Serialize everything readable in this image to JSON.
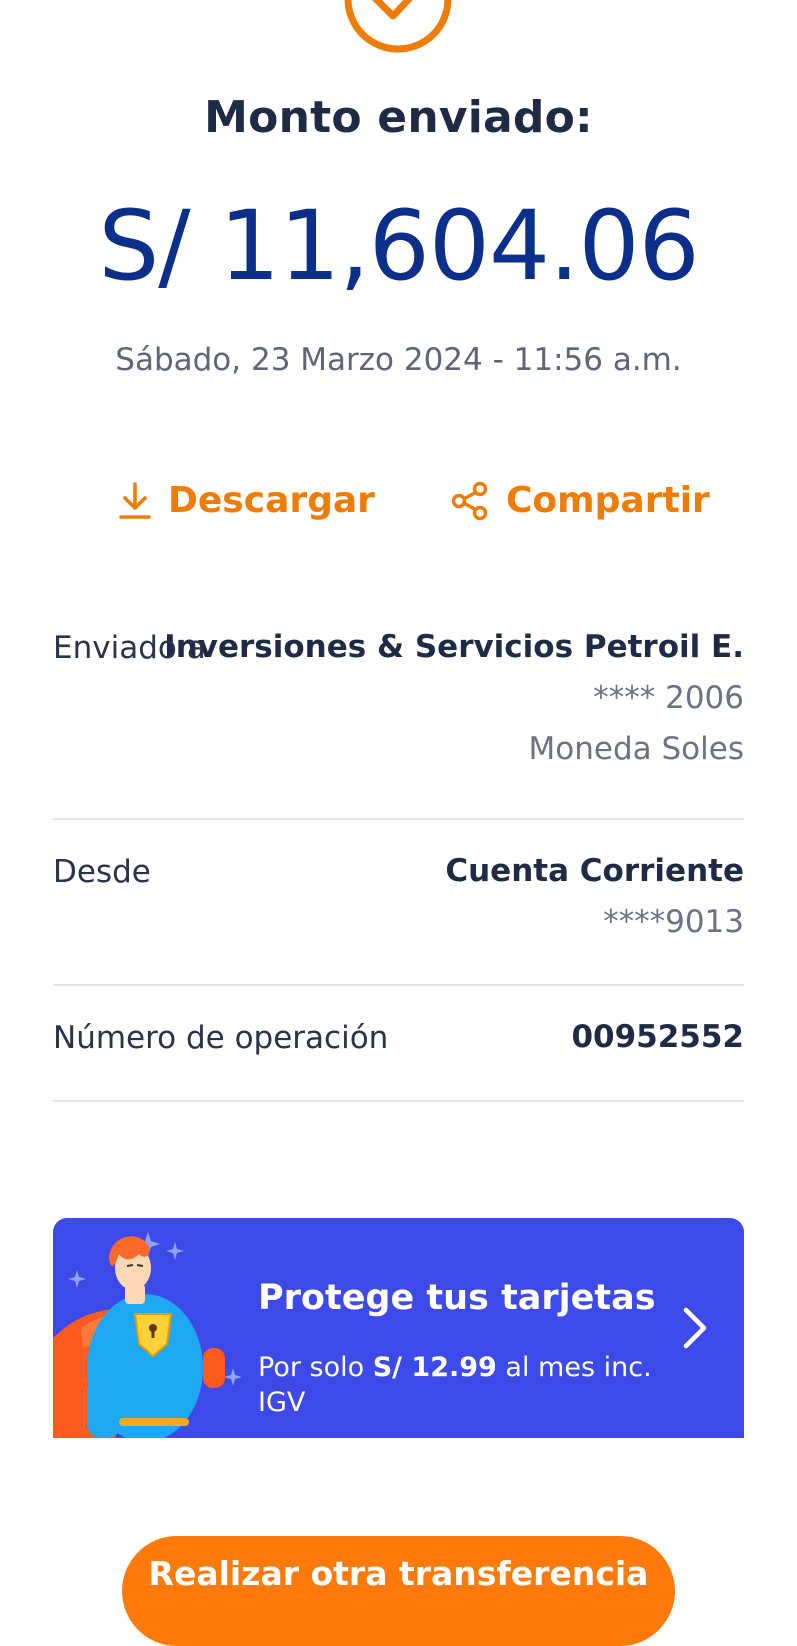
{
  "header": {
    "icon": "check-circle-icon",
    "title": "Monto enviado:",
    "amount": "S/ 11,604.06",
    "datetime": "Sábado, 23 Marzo 2024 - 11:56 a.m."
  },
  "actions": {
    "download": {
      "label": "Descargar",
      "icon": "download-icon"
    },
    "share": {
      "label": "Compartir",
      "icon": "share-icon"
    }
  },
  "details": {
    "sent_to": {
      "label": "Enviado a",
      "name": "Inversiones & Servicios Petroil E.",
      "account": "**** 2006",
      "currency": "Moneda Soles"
    },
    "from": {
      "label": "Desde",
      "account_type": "Cuenta Corriente",
      "account": "****9013"
    },
    "operation": {
      "label": "Número de operación",
      "number": "00952552"
    }
  },
  "promo": {
    "title": "Protege tus tarjetas",
    "text_prefix": "Por solo ",
    "price": "S/ 12.99",
    "text_suffix": " al mes inc. IGV",
    "icon": "chevron-right-icon"
  },
  "cta": {
    "label": "Realizar otra transferencia"
  },
  "colors": {
    "accent": "#f07c08",
    "amount": "#0b2f8a",
    "promo_bg": "#3d4ae8",
    "cta_bg": "#ff7a0a"
  }
}
